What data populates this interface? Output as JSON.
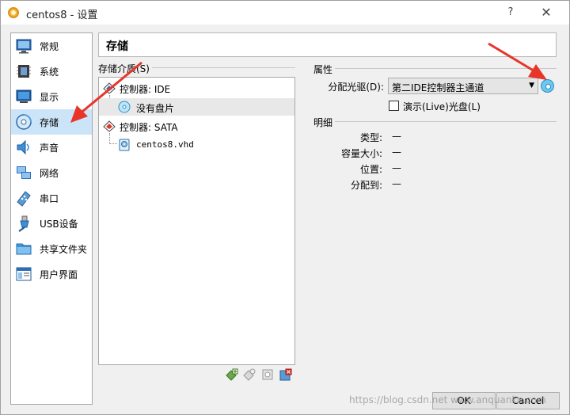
{
  "window": {
    "title": "centos8 - 设置",
    "help": "?",
    "close": "✕"
  },
  "sidebar": {
    "items": [
      {
        "label": "常规",
        "icon": "monitor-general-icon"
      },
      {
        "label": "系统",
        "icon": "chip-icon"
      },
      {
        "label": "显示",
        "icon": "display-icon"
      },
      {
        "label": "存储",
        "icon": "storage-disk-icon",
        "selected": true
      },
      {
        "label": "声音",
        "icon": "speaker-icon"
      },
      {
        "label": "网络",
        "icon": "network-icon"
      },
      {
        "label": "串口",
        "icon": "serial-port-icon"
      },
      {
        "label": "USB设备",
        "icon": "usb-icon"
      },
      {
        "label": "共享文件夹",
        "icon": "folder-icon"
      },
      {
        "label": "用户界面",
        "icon": "user-interface-icon"
      }
    ]
  },
  "page": {
    "title": "存储"
  },
  "storage_media": {
    "label": "存储介质(S)",
    "tree": [
      {
        "label": "控制器: IDE",
        "type": "controller"
      },
      {
        "label": "没有盘片",
        "type": "optical-empty",
        "selected": true
      },
      {
        "label": "控制器: SATA",
        "type": "controller"
      },
      {
        "label": "centos8.vhd",
        "type": "hard-disk"
      }
    ],
    "toolbar": [
      "add-controller-icon",
      "add-attachment-icon",
      "remove-attachment-icon",
      "remove-controller-icon"
    ]
  },
  "attributes": {
    "label": "属性",
    "optical_drive_label": "分配光驱(D):",
    "optical_drive_value": "第二IDE控制器主通道",
    "live_cd_label": "演示(Live)光盘(L)",
    "live_cd_checked": false
  },
  "details": {
    "label": "明细",
    "rows": [
      {
        "key": "类型:",
        "value": "—"
      },
      {
        "key": "容量大小:",
        "value": "—"
      },
      {
        "key": "位置:",
        "value": "—"
      },
      {
        "key": "分配到:",
        "value": "—"
      }
    ]
  },
  "buttons": {
    "ok": "OK",
    "cancel": "Cancel"
  },
  "watermark": "https://blog.csdn.net  www.anquanke.com",
  "colors": {
    "selected_bg": "#cce4f7",
    "arrow": "#e8352a"
  }
}
